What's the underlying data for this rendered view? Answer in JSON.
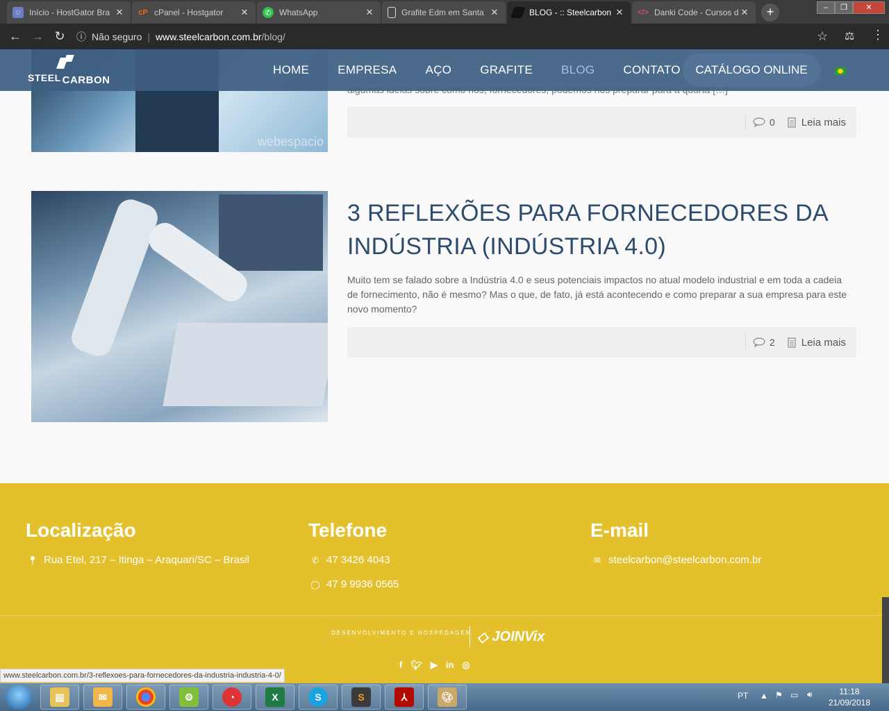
{
  "browser": {
    "tabs": [
      {
        "label": "Início - HostGator Bra",
        "icon_color": "#6a7fc4"
      },
      {
        "label": "cPanel - Hostgator",
        "icon_color": "#e9632a"
      },
      {
        "label": "WhatsApp",
        "icon_color": "#2fbf4c"
      },
      {
        "label": "Grafite Edm em Santa",
        "icon_color": "#ffffff"
      },
      {
        "label": "BLOG - :: Steelcarbon",
        "icon_color": "#222222"
      },
      {
        "label": "Danki Code - Cursos d",
        "icon_color": "#d04b6e"
      }
    ],
    "security_label": "Não seguro",
    "url_domain": "www.steelcarbon.com.br",
    "url_path": "/blog/"
  },
  "site": {
    "logo_top": "STEEL",
    "logo_bottom": "CARBON",
    "nav": [
      "HOME",
      "EMPRESA",
      "AÇO",
      "GRAFITE",
      "BLOG",
      "CONTATO"
    ],
    "catalog_label": "CATÁLOGO ONLINE"
  },
  "posts": [
    {
      "excerpt_tail": "algumas ideias sobre como nós, fornecedores, podemos nos preparar para a quarta […]",
      "comments": "0",
      "read_more": "Leia mais",
      "image_watermark": "webespacio"
    },
    {
      "title": "3 REFLEXÕES PARA FORNECEDORES DA INDÚSTRIA (INDÚSTRIA 4.0)",
      "excerpt": "Muito tem se falado sobre a Indústria 4.0 e seus potenciais impactos no atual modelo industrial e em toda a cadeia de fornecimento, não é mesmo? Mas o que, de fato, já está acontecendo e como preparar a sua empresa para este novo momento?",
      "comments": "2",
      "read_more": "Leia mais"
    }
  ],
  "footer": {
    "location_title": "Localização",
    "address": "Rua Etel, 217 – Itinga – Araquari/SC – Brasil",
    "phone_title": "Telefone",
    "phone": "47 3426 4043",
    "whatsapp": "47 9 9936 0565",
    "email_title": "E-mail",
    "email": "steelcarbon@steelcarbon.com.br",
    "credit": "DESENVOLVIMENTO E HOSPEDAGEM",
    "credit_brand": "JOINVix"
  },
  "status_url": "www.steelcarbon.com.br/3-reflexoes-para-fornecedores-da-industria-industria-4-0/",
  "taskbar": {
    "language": "PT",
    "time": "11:18",
    "date": "21/09/2018"
  }
}
